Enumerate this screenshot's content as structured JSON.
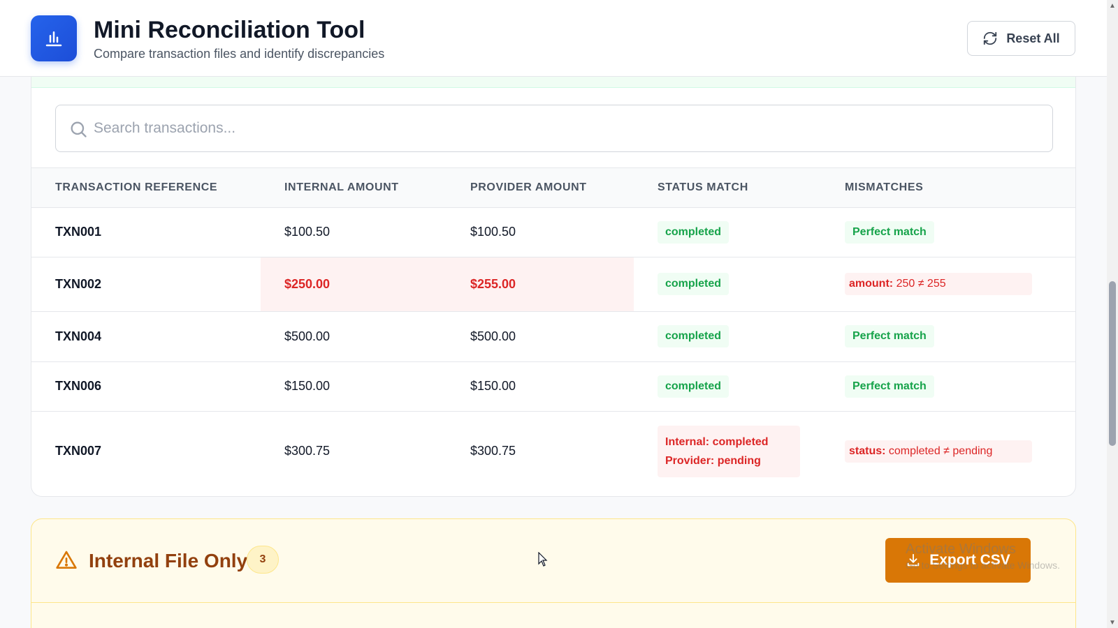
{
  "header": {
    "title": "Mini Reconciliation Tool",
    "subtitle": "Compare transaction files and identify discrepancies",
    "reset_label": "Reset All",
    "logo_icon": "bar-chart-icon",
    "accent": "#2563eb"
  },
  "search": {
    "placeholder": "Search transactions...",
    "value": ""
  },
  "table": {
    "columns": [
      "Transaction Reference",
      "Internal Amount",
      "Provider Amount",
      "Status Match",
      "Mismatches"
    ],
    "rows": [
      {
        "ref": "TXN001",
        "internal": "$100.50",
        "provider": "$100.50",
        "status": "completed",
        "mismatch": "Perfect match"
      },
      {
        "ref": "TXN002",
        "internal": "$250.00",
        "provider": "$255.00",
        "status": "completed",
        "mismatch_field": "amount:",
        "mismatch_detail": "250 ≠ 255"
      },
      {
        "ref": "TXN004",
        "internal": "$500.00",
        "provider": "$500.00",
        "status": "completed",
        "mismatch": "Perfect match"
      },
      {
        "ref": "TXN006",
        "internal": "$150.00",
        "provider": "$150.00",
        "status": "completed",
        "mismatch": "Perfect match"
      },
      {
        "ref": "TXN007",
        "internal": "$300.75",
        "provider": "$300.75",
        "status_internal": "Internal: completed",
        "status_provider": "Provider: pending",
        "mismatch_field": "status:",
        "mismatch_detail": "completed ≠ pending"
      }
    ]
  },
  "internal_only": {
    "title": "Internal File Only",
    "count": "3",
    "export_label": "Export CSV",
    "accent": "#d97706"
  },
  "watermark": {
    "title": "Activate Windows",
    "subtitle": "Go to Settings to activate Windows."
  },
  "colors": {
    "match_green": "#16a34a",
    "mismatch_red": "#dc2626",
    "warning_amber": "#92400e"
  }
}
